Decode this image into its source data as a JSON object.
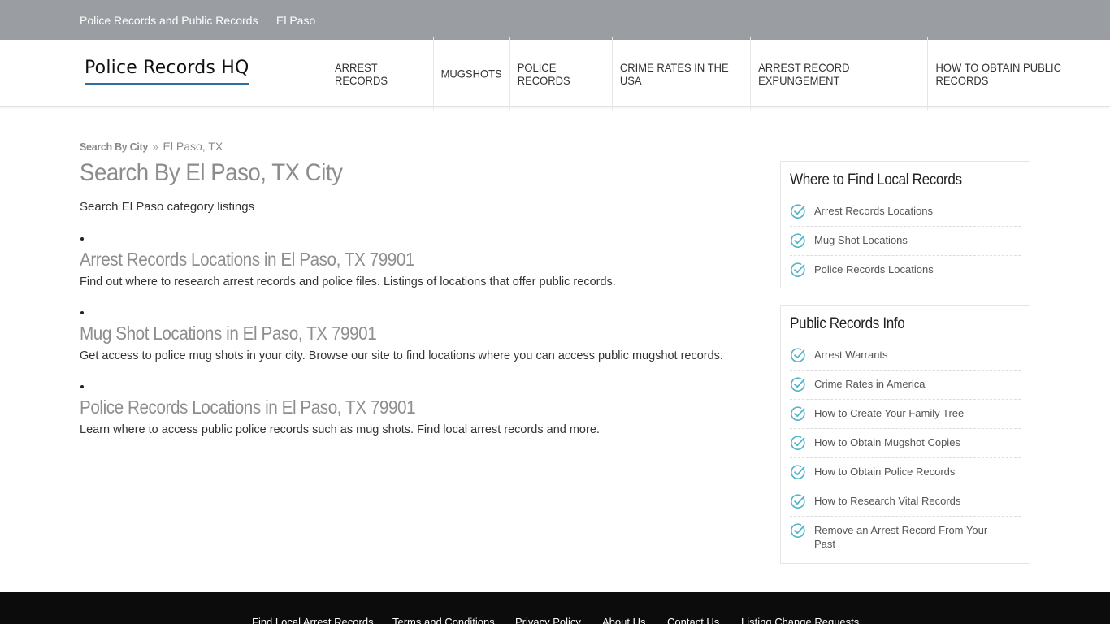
{
  "topbar": {
    "links": [
      "Police Records and Public Records",
      "El Paso"
    ]
  },
  "header": {
    "logo_text": "Police Records HQ",
    "nav": [
      "ARREST RECORDS",
      "MUGSHOTS",
      "POLICE RECORDS",
      "CRIME RATES IN THE USA",
      "ARREST RECORD EXPUNGEMENT",
      "HOW TO OBTAIN PUBLIC RECORDS"
    ]
  },
  "breadcrumb": {
    "link": "Search By City",
    "separator": "»",
    "current": "El Paso, TX"
  },
  "main": {
    "title": "Search By El Paso, TX City",
    "intro": "Search El Paso category listings",
    "listings": [
      {
        "title": "Arrest Records Locations in El Paso, TX 79901",
        "desc": "Find out where to research arrest records and police files. Listings of locations that offer public records."
      },
      {
        "title": "Mug Shot Locations in El Paso, TX 79901",
        "desc": "Get access to police mug shots in your city. Browse our site to find locations where you can access public mugshot records."
      },
      {
        "title": "Police Records Locations in El Paso, TX 79901",
        "desc": "Learn where to access public police records such as mug shots. Find local arrest records and more."
      }
    ]
  },
  "sidebar": {
    "widgets": [
      {
        "title": "Where to Find Local Records",
        "items": [
          "Arrest Records Locations",
          "Mug Shot Locations",
          "Police Records Locations"
        ]
      },
      {
        "title": "Public Records Info",
        "items": [
          "Arrest Warrants",
          "Crime Rates in America",
          "How to Create Your Family Tree",
          "How to Obtain Mugshot Copies",
          "How to Obtain Police Records",
          "How to Research Vital Records",
          "Remove an Arrest Record From Your Past"
        ]
      }
    ]
  },
  "footer": {
    "links": [
      "Find Local Arrest Records",
      "Terms and Conditions",
      "Privacy Policy",
      "About Us",
      "Contact Us",
      "Listing Change Requests"
    ]
  },
  "colors": {
    "topbar_bg": "#9a9ea2",
    "logo_underline": "#2f6e9b",
    "check_icon": "#4fb3c9",
    "footer_bg": "#0c0c0c"
  },
  "icons": {
    "list_item": "check-circle-icon"
  }
}
